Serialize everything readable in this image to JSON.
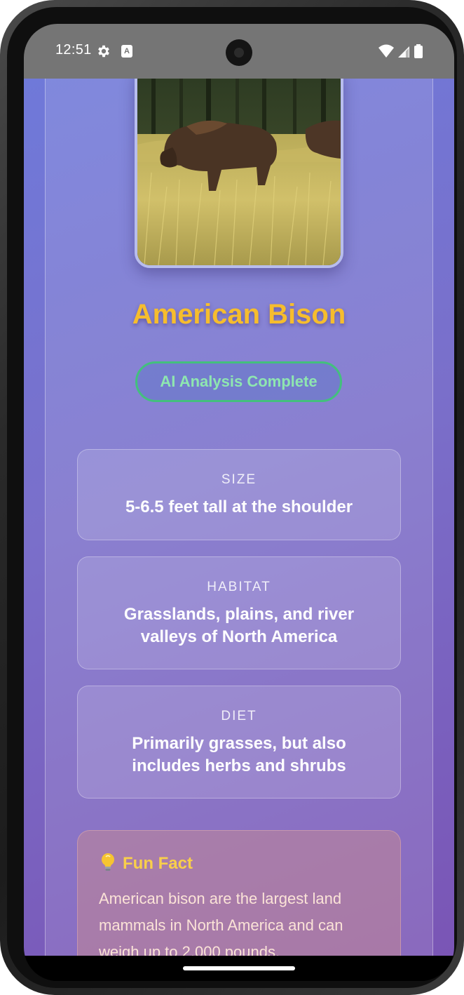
{
  "status_bar": {
    "time": "12:51",
    "icons": [
      "gear-icon",
      "text-a-icon",
      "wifi-icon",
      "cellular-signal-icon",
      "battery-icon"
    ],
    "a_glyph": "A"
  },
  "animal": {
    "name": "American Bison",
    "photo_icon": "bison-photo",
    "analysis_status": "AI Analysis Complete"
  },
  "info_cards": {
    "size": {
      "label": "SIZE",
      "value": "5-6.5 feet tall at the shoulder"
    },
    "habitat": {
      "label": "HABITAT",
      "value": "Grasslands, plains, and river valleys of North America"
    },
    "diet": {
      "label": "DIET",
      "value": "Primarily grasses, but also includes herbs and shrubs"
    }
  },
  "fun_fact": {
    "icon": "lightbulb-icon",
    "title": "Fun Fact",
    "text": "American bison are the largest land mammals in North America and can weigh up to 2,000 pounds."
  },
  "colors": {
    "title": "#f6bd2d",
    "pill_border": "#43c07d",
    "pill_text": "#8ee6b0",
    "fun_title": "#f9cf4a",
    "background_start": "#6f79d9",
    "background_end": "#7a55b5"
  }
}
